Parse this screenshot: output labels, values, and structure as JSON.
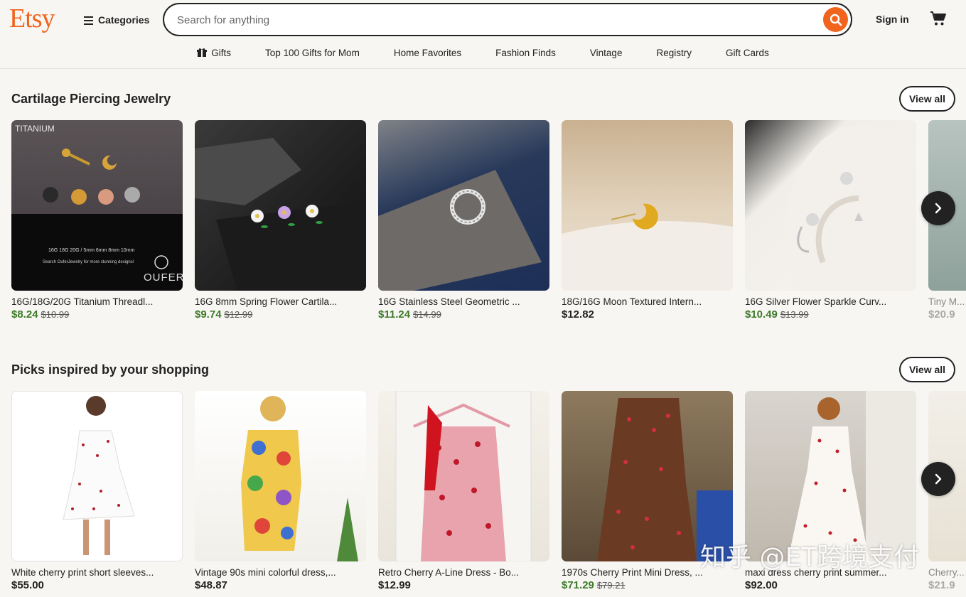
{
  "header": {
    "logo": "Etsy",
    "categories_label": "Categories",
    "search_placeholder": "Search for anything",
    "signin_label": "Sign in"
  },
  "nav": [
    {
      "label": "Gifts",
      "icon": "gift-icon"
    },
    {
      "label": "Top 100 Gifts for Mom"
    },
    {
      "label": "Home Favorites"
    },
    {
      "label": "Fashion Finds"
    },
    {
      "label": "Vintage"
    },
    {
      "label": "Registry"
    },
    {
      "label": "Gift Cards"
    }
  ],
  "sections": [
    {
      "title": "Cartilage Piercing Jewelry",
      "view_all": "View all",
      "items": [
        {
          "title": "16G/18G/20G Titanium Threadl...",
          "price": "$8.24",
          "original": "$10.99",
          "sale": true,
          "image_text": "TITANIUM",
          "brand": "OUFER"
        },
        {
          "title": "16G 8mm Spring Flower Cartila...",
          "price": "$9.74",
          "original": "$12.99",
          "sale": true
        },
        {
          "title": "16G Stainless Steel Geometric ...",
          "price": "$11.24",
          "original": "$14.99",
          "sale": true
        },
        {
          "title": "18G/16G Moon Textured Intern...",
          "price": "$12.82",
          "original": "",
          "sale": false
        },
        {
          "title": "16G Silver Flower Sparkle Curv...",
          "price": "$10.49",
          "original": "$13.99",
          "sale": true
        },
        {
          "title": "Tiny M...",
          "price": "$20.9",
          "original": "",
          "sale": false
        }
      ]
    },
    {
      "title": "Picks inspired by your shopping",
      "view_all": "View all",
      "items": [
        {
          "title": "White cherry print short sleeves...",
          "price": "$55.00",
          "original": "",
          "sale": false
        },
        {
          "title": "Vintage 90s mini colorful dress,...",
          "price": "$48.87",
          "original": "",
          "sale": false
        },
        {
          "title": "Retro Cherry A-Line Dress - Bo...",
          "price": "$12.99",
          "original": "",
          "sale": false
        },
        {
          "title": "1970s Cherry Print Mini Dress, ...",
          "price": "$71.29",
          "original": "$79.21",
          "sale": true
        },
        {
          "title": "maxi dress cherry print summer...",
          "price": "$92.00",
          "original": "",
          "sale": false
        },
        {
          "title": "Cherry...",
          "price": "$21.9",
          "original": "",
          "sale": false
        }
      ]
    }
  ],
  "watermark": "知乎 @ET跨境支付",
  "colors": {
    "brand": "#f1641e",
    "sale_price": "#3d7a28"
  }
}
